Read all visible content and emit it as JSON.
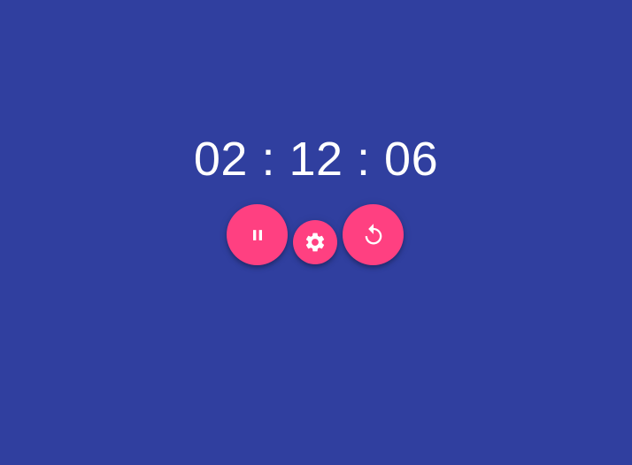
{
  "timer": {
    "display": "02 : 12 : 06",
    "hours": "02",
    "minutes": "12",
    "seconds": "06"
  },
  "controls": {
    "pause_icon": "pause-icon",
    "settings_icon": "gear-icon",
    "reset_icon": "replay-icon"
  },
  "colors": {
    "background": "#303f9f",
    "accent": "#ff4081",
    "text": "#ffffff"
  }
}
